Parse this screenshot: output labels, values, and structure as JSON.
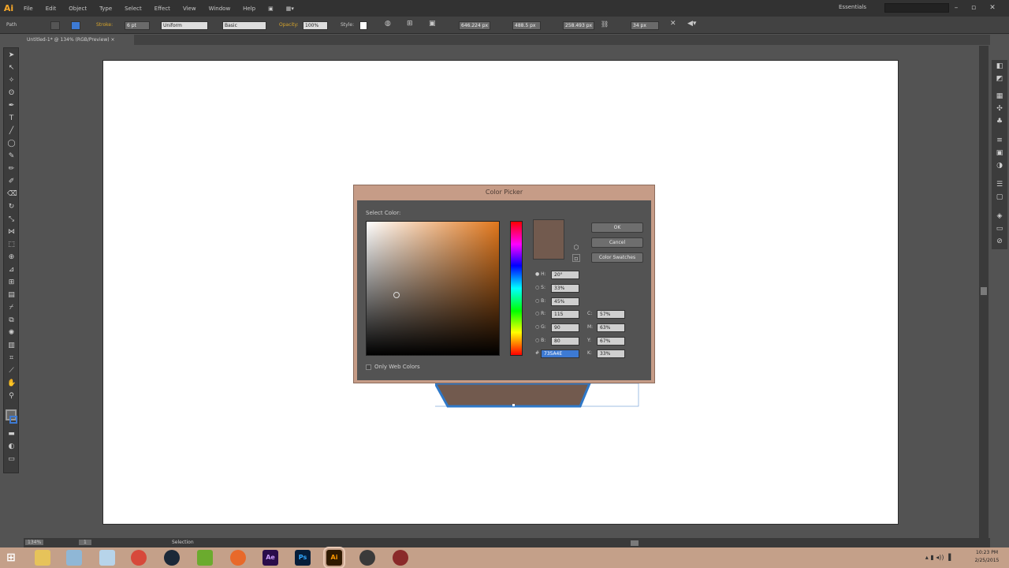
{
  "app": {
    "logo": "Ai"
  },
  "menu": [
    "File",
    "Edit",
    "Object",
    "Type",
    "Select",
    "Effect",
    "View",
    "Window",
    "Help"
  ],
  "workspace": "Essentials",
  "control_bar": {
    "selection_label": "Path",
    "stroke_label": "Stroke:",
    "stroke_weight": "6 pt",
    "stroke_profile": "Uniform",
    "brush": "Basic",
    "opacity_label": "Opacity:",
    "opacity": "100%",
    "style_label": "Style:",
    "x": "646.224 px",
    "y": "488.5 px",
    "w": "258.493 px",
    "h": "34 px"
  },
  "document_tab": "Untitled-1* @ 134% (RGB/Preview)",
  "dialog": {
    "title": "Color Picker",
    "select_color": "Select Color:",
    "ok": "OK",
    "cancel": "Cancel",
    "color_swatches": "Color Swatches",
    "fields": {
      "H": "20°",
      "S": "33%",
      "B": "45%",
      "R": "115",
      "G": "90",
      "B2": "80",
      "hex": "735A4E",
      "C": "57%",
      "M": "63%",
      "Y": "67%",
      "K": "33%"
    },
    "web_colors": "Only Web Colors",
    "colors": {
      "new_color": "#725a4e",
      "hue": "#e1771c"
    }
  },
  "status": {
    "zoom": "134%",
    "page": "1",
    "mode": "Selection"
  },
  "clock": {
    "time": "10:23 PM",
    "date": "2/25/2015"
  },
  "taskbar": [
    "windows-start",
    "file-explorer",
    "browser",
    "notepad",
    "chrome",
    "steam",
    "xbox",
    "firefox",
    "after-effects",
    "photoshop",
    "illustrator",
    "eye-app",
    "tool-app"
  ],
  "taskbar_labels": {
    "ae": "Ae",
    "ps": "Ps",
    "ai": "Ai"
  }
}
